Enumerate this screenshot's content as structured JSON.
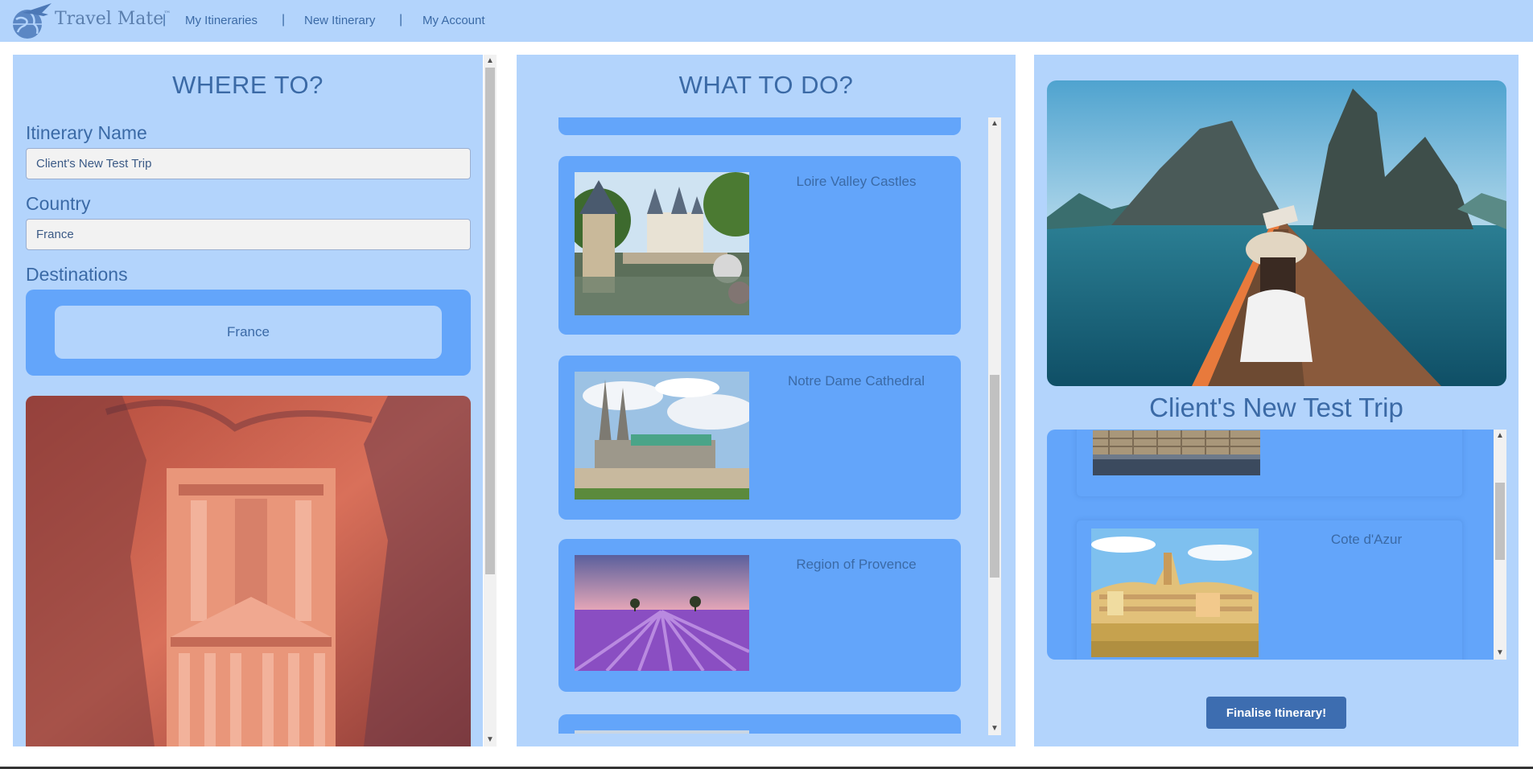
{
  "nav": {
    "brand": "Travel Mate",
    "trademark": "™",
    "separator": "|",
    "links": [
      "My Itineraries",
      "New Itinerary",
      "My Account"
    ]
  },
  "left": {
    "title": "WHERE TO?",
    "itinerary_label": "Itinerary Name",
    "itinerary_value": "Client's New Test Trip",
    "country_label": "Country",
    "country_value": "France",
    "destinations_label": "Destinations",
    "destinations": [
      "France"
    ]
  },
  "middle": {
    "title": "WHAT TO DO?",
    "activities": [
      "Loire Valley Castles",
      "Notre Dame Cathedral",
      "Region of Provence"
    ]
  },
  "right": {
    "trip_title": "Client's New Test Trip",
    "selected": [
      "Cote d'Azur"
    ],
    "finalise_label": "Finalise Itinerary!"
  },
  "colors": {
    "panel_bg": "#b3d4fc",
    "card_bg": "#63a5fa",
    "text_accent": "#3b6aa6",
    "button_bg": "#3d6db0"
  },
  "scroll": {
    "left_position": 0.0,
    "middle_position": 0.55,
    "right_position": 0.5
  }
}
